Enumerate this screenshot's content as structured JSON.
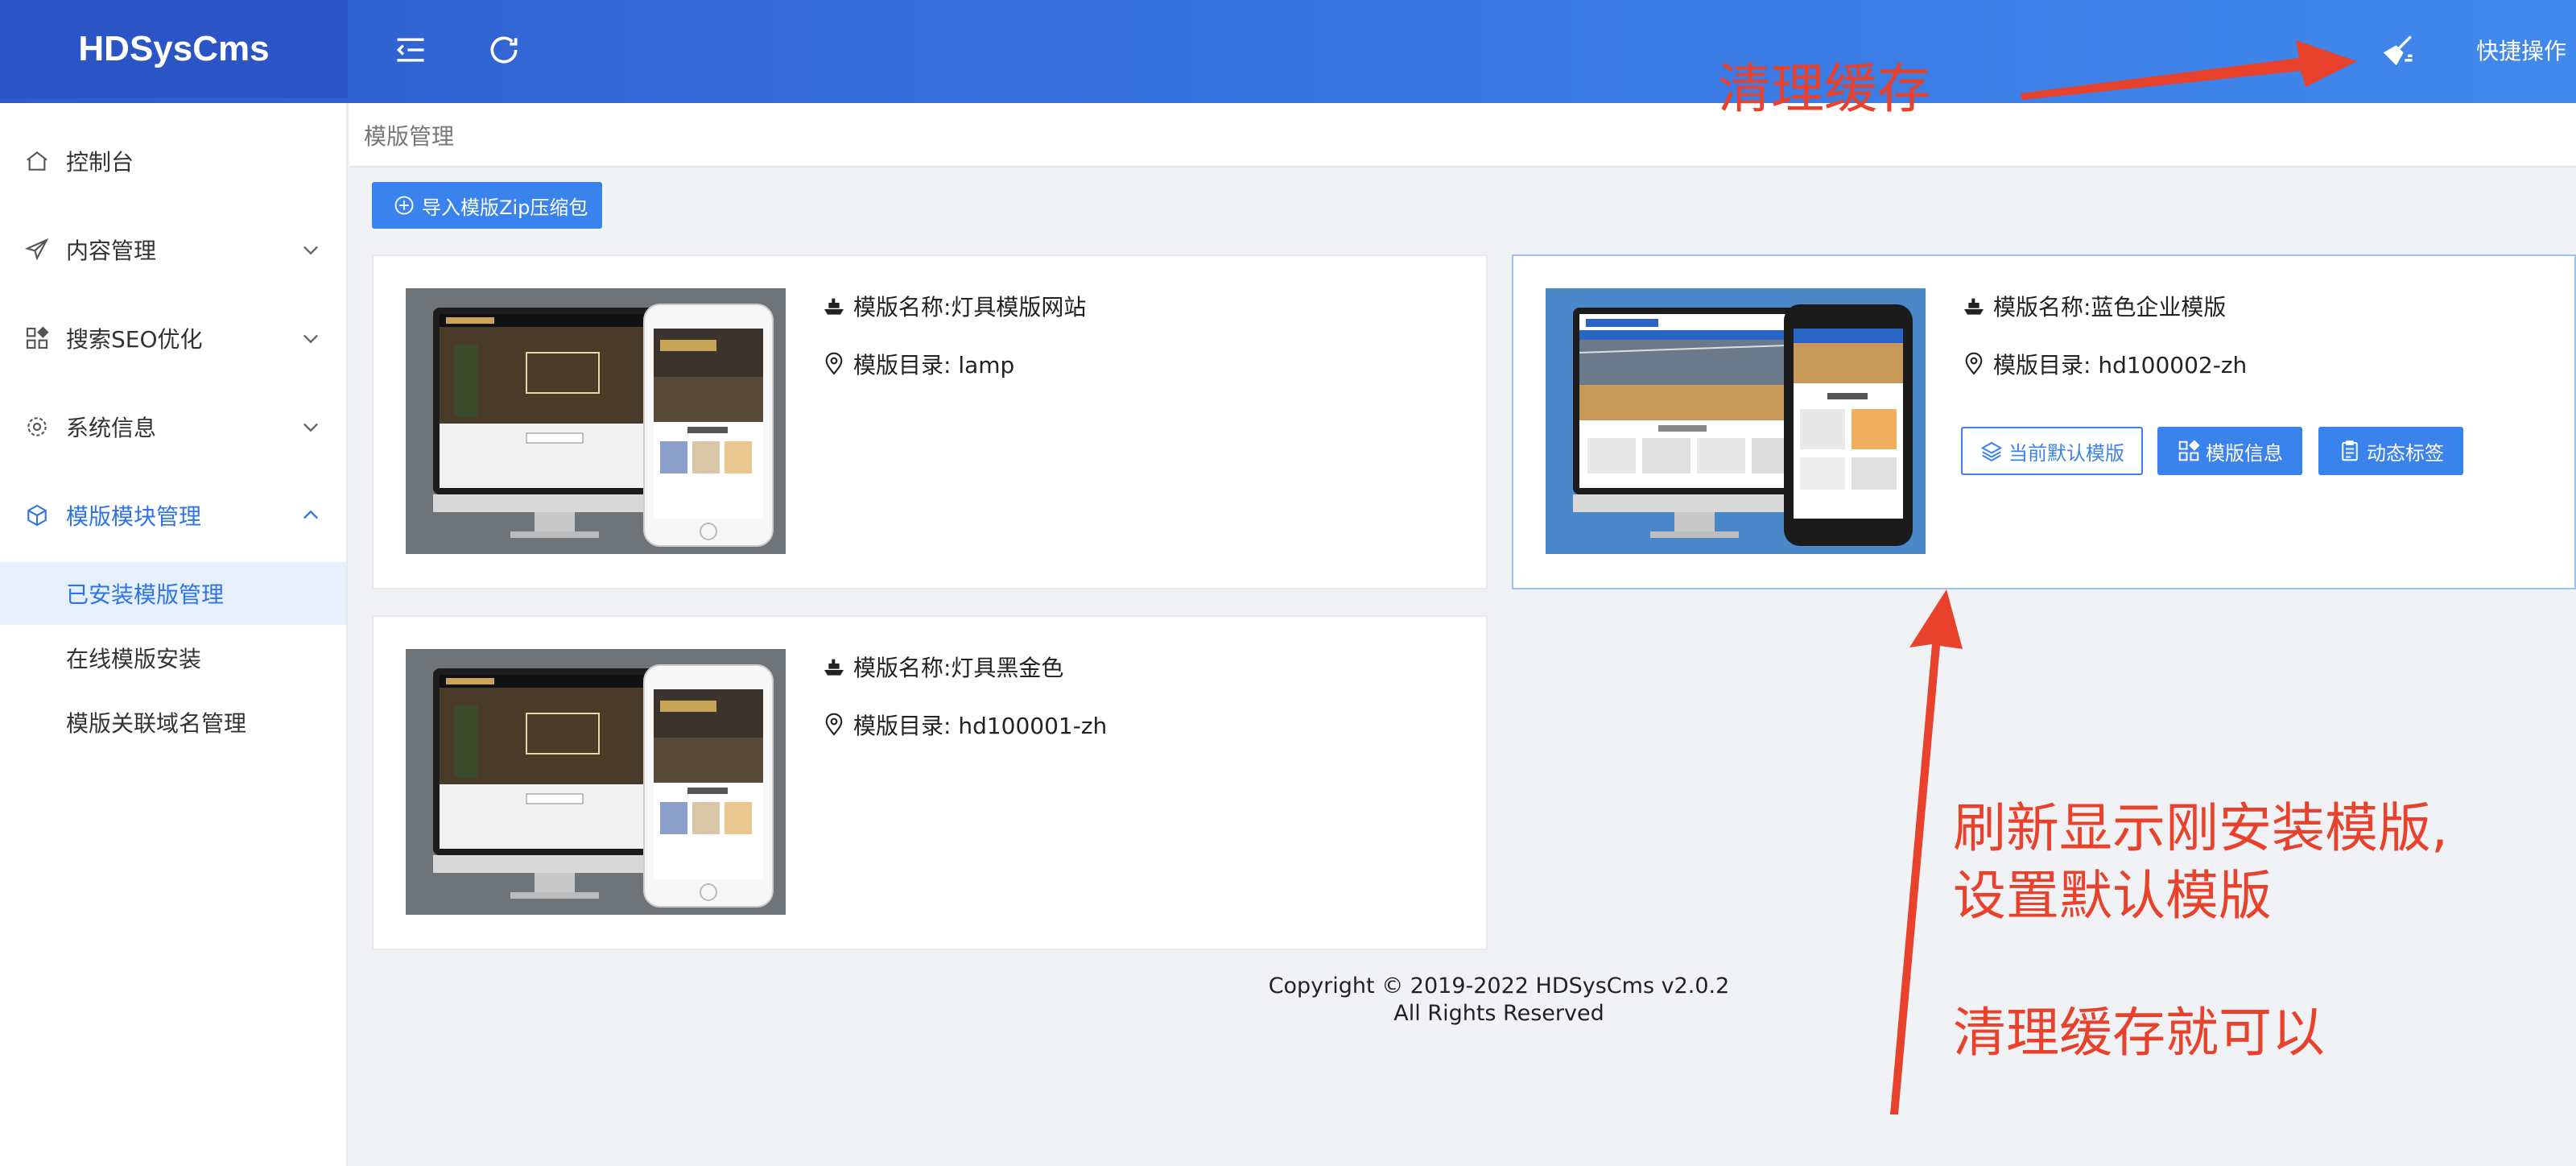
{
  "app": {
    "brand": "HDSysCms"
  },
  "header": {
    "collapse_icon": "menu-fold-icon",
    "refresh_icon": "refresh-icon",
    "clear_cache_icon": "broom-icon",
    "quick_ops_label": "快捷操作"
  },
  "sidebar": {
    "items": [
      {
        "label": "控制台",
        "icon": "home-icon",
        "expandable": false
      },
      {
        "label": "内容管理",
        "icon": "send-icon",
        "expandable": true
      },
      {
        "label": "搜索SEO优化",
        "icon": "apps-icon",
        "expandable": true
      },
      {
        "label": "系统信息",
        "icon": "gear-icon",
        "expandable": true
      },
      {
        "label": "模版模块管理",
        "icon": "cube-icon",
        "expandable": true,
        "expanded": true,
        "active": true
      }
    ],
    "subitems": [
      {
        "label": "已安装模版管理",
        "selected": true
      },
      {
        "label": "在线模版安装",
        "selected": false
      },
      {
        "label": "模版关联域名管理",
        "selected": false
      }
    ]
  },
  "breadcrumb": {
    "title": "模版管理"
  },
  "toolbar": {
    "import_label": "导入模版Zip压缩包"
  },
  "templates": [
    {
      "name": "模版名称:灯具模版网站",
      "dir": "模版目录: lamp",
      "preview_style": "dark"
    },
    {
      "name": "模版名称:蓝色企业模版",
      "dir": "模版目录: hd100002-zh",
      "preview_style": "blue",
      "is_current": true,
      "actions": {
        "default_label": "当前默认模版",
        "info_label": "模版信息",
        "tags_label": "动态标签"
      }
    },
    {
      "name": "模版名称:灯具黑金色",
      "dir": "模版目录: hd100001-zh",
      "preview_style": "dark"
    }
  ],
  "footer": {
    "copyright": "Copyright © 2019-2022 HDSysCms v2.0.2",
    "rights": "All Rights Reserved"
  },
  "annotations": {
    "clear_cache": "清理缓存",
    "refresh_line1": "刷新显示刚安装模版,",
    "refresh_line2": "设置默认模版",
    "clear_cache_done": "清理缓存就可以"
  },
  "colors": {
    "primary": "#3a82ec",
    "header_start": "#2e5ccd",
    "header_end": "#4189ec",
    "annotation": "#e8412c"
  }
}
